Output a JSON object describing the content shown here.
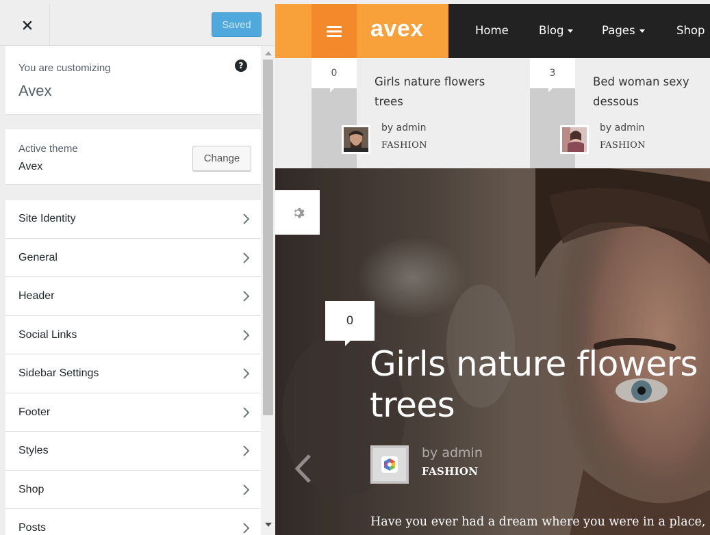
{
  "customizer": {
    "saved_label": "Saved",
    "info": {
      "label": "You are customizing",
      "site_name": "Avex"
    },
    "theme": {
      "label": "Active theme",
      "name": "Avex",
      "change_label": "Change"
    },
    "sections": [
      {
        "label": "Site Identity"
      },
      {
        "label": "General"
      },
      {
        "label": "Header"
      },
      {
        "label": "Social Links"
      },
      {
        "label": "Sidebar Settings"
      },
      {
        "label": "Footer"
      },
      {
        "label": "Styles"
      },
      {
        "label": "Shop"
      },
      {
        "label": "Posts"
      }
    ]
  },
  "preview": {
    "logo": "avex",
    "nav": [
      {
        "label": "Home"
      },
      {
        "label": "Blog"
      },
      {
        "label": "Pages"
      },
      {
        "label": "Shop"
      }
    ],
    "ticker": [
      {
        "count": "0",
        "title": "Girls nature flowers trees",
        "author": "by  admin",
        "category": "FASHION"
      },
      {
        "count": "3",
        "title": "Bed woman sexy dessous",
        "author": "by  admin",
        "category": "FASHION"
      }
    ],
    "hero": {
      "count": "0",
      "title": "Girls nature flowers trees",
      "author": "by  admin",
      "category": "FASHION",
      "excerpt": "Have you ever had a dream where you were in a place,"
    }
  },
  "colors": {
    "accent_orange": "#f8a039",
    "accent_orange_dark": "#f3892a",
    "nav_dark": "#222222",
    "saved_blue": "#4fa9dd"
  }
}
